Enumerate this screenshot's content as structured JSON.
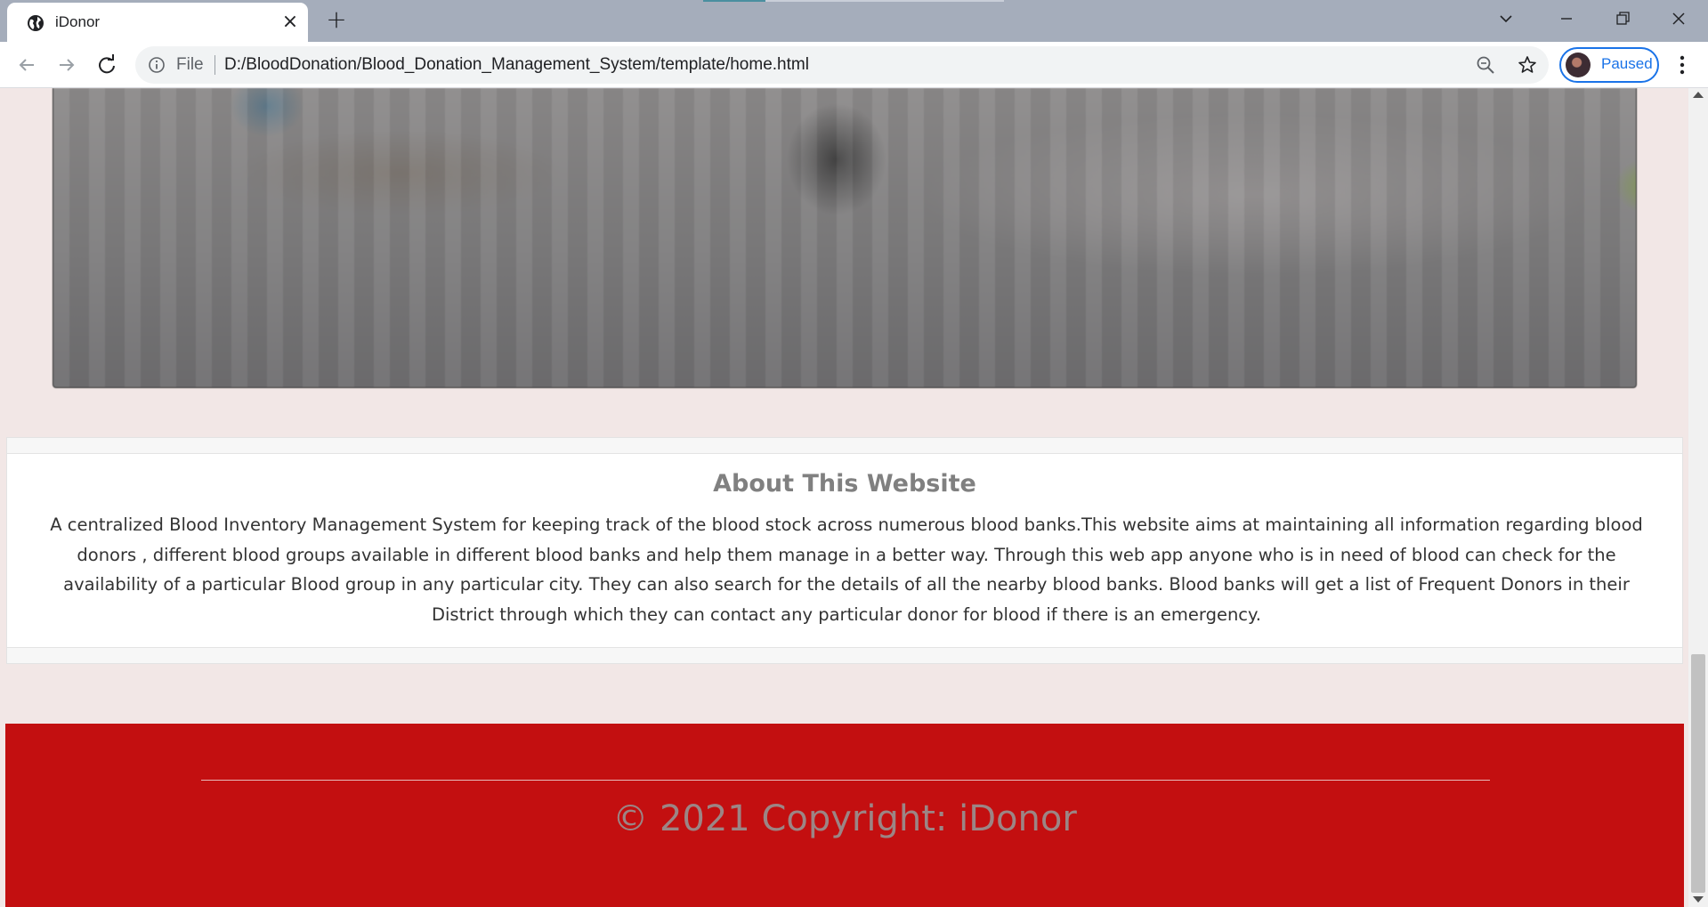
{
  "browser": {
    "tab_title": "iDonor",
    "omnibox_scheme": "File",
    "url": "D:/BloodDonation/Blood_Donation_Management_System/template/home.html",
    "profile_status": "Paused"
  },
  "page": {
    "about": {
      "title": "About This Website",
      "body": "A centralized Blood Inventory Management System for keeping track of the blood stock across numerous blood banks.This website aims at maintaining all information regarding blood donors , different blood groups available in different blood banks and help them manage in a better way. Through this web app anyone who is in need of blood can check for the availability of a particular Blood group in any particular city. They can also search for the details of all the nearby blood banks. Blood banks will get a list of Frequent Donors in their District through which they can contact any particular donor for blood if there is an emergency."
    },
    "footer": {
      "copyright": "© 2021 Copyright: iDonor"
    }
  },
  "colors": {
    "page_bg": "#f2e7e6",
    "footer_red": "#c30f10",
    "accent_blue": "#1a73e8"
  },
  "icons": [
    "globe-icon",
    "close-icon",
    "plus-icon",
    "chevron-down-icon",
    "minimize-icon",
    "restore-icon",
    "window-close-icon",
    "back-arrow-icon",
    "forward-arrow-icon",
    "reload-icon",
    "info-icon",
    "zoom-out-icon",
    "star-icon",
    "kebab-menu-icon"
  ]
}
